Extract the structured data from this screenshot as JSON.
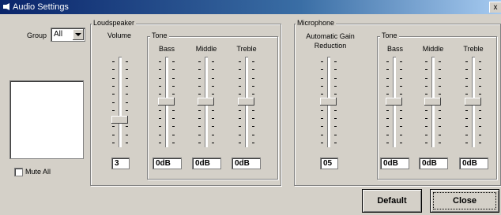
{
  "window": {
    "title": "Audio Settings",
    "close_glyph": "x"
  },
  "group_selector": {
    "label": "Group",
    "value": "All"
  },
  "mute_all": {
    "label": "Mute All",
    "checked": false
  },
  "loudspeaker": {
    "title": "Loudspeaker",
    "volume": {
      "label": "Volume",
      "value": "3",
      "level": 0.27
    },
    "tone": {
      "title": "Tone",
      "bass": {
        "label": "Bass",
        "value": "0dB",
        "level": 0.5
      },
      "middle": {
        "label": "Middle",
        "value": "0dB",
        "level": 0.5
      },
      "treble": {
        "label": "Treble",
        "value": "0dB",
        "level": 0.5
      }
    }
  },
  "microphone": {
    "title": "Microphone",
    "agc": {
      "label_line1": "Automatic Gain",
      "label_line2": "Reduction",
      "value": "05",
      "level": 0.5
    },
    "tone": {
      "title": "Tone",
      "bass": {
        "label": "Bass",
        "value": "0dB",
        "level": 0.5
      },
      "middle": {
        "label": "Middle",
        "value": "0dB",
        "level": 0.5
      },
      "treble": {
        "label": "Treble",
        "value": "0dB",
        "level": 0.5
      }
    }
  },
  "buttons": {
    "default": "Default",
    "close": "Close"
  }
}
